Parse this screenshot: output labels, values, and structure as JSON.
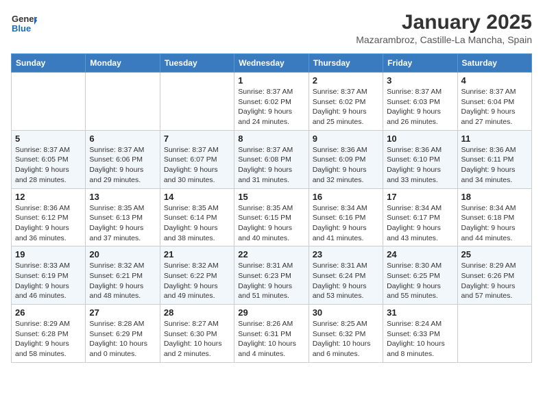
{
  "logo": {
    "line1": "General",
    "line2": "Blue"
  },
  "title": "January 2025",
  "subtitle": "Mazarambroz, Castille-La Mancha, Spain",
  "weekdays": [
    "Sunday",
    "Monday",
    "Tuesday",
    "Wednesday",
    "Thursday",
    "Friday",
    "Saturday"
  ],
  "weeks": [
    [
      {
        "day": "",
        "sunrise": "",
        "sunset": "",
        "daylight": ""
      },
      {
        "day": "",
        "sunrise": "",
        "sunset": "",
        "daylight": ""
      },
      {
        "day": "",
        "sunrise": "",
        "sunset": "",
        "daylight": ""
      },
      {
        "day": "1",
        "sunrise": "Sunrise: 8:37 AM",
        "sunset": "Sunset: 6:02 PM",
        "daylight": "Daylight: 9 hours and 24 minutes."
      },
      {
        "day": "2",
        "sunrise": "Sunrise: 8:37 AM",
        "sunset": "Sunset: 6:02 PM",
        "daylight": "Daylight: 9 hours and 25 minutes."
      },
      {
        "day": "3",
        "sunrise": "Sunrise: 8:37 AM",
        "sunset": "Sunset: 6:03 PM",
        "daylight": "Daylight: 9 hours and 26 minutes."
      },
      {
        "day": "4",
        "sunrise": "Sunrise: 8:37 AM",
        "sunset": "Sunset: 6:04 PM",
        "daylight": "Daylight: 9 hours and 27 minutes."
      }
    ],
    [
      {
        "day": "5",
        "sunrise": "Sunrise: 8:37 AM",
        "sunset": "Sunset: 6:05 PM",
        "daylight": "Daylight: 9 hours and 28 minutes."
      },
      {
        "day": "6",
        "sunrise": "Sunrise: 8:37 AM",
        "sunset": "Sunset: 6:06 PM",
        "daylight": "Daylight: 9 hours and 29 minutes."
      },
      {
        "day": "7",
        "sunrise": "Sunrise: 8:37 AM",
        "sunset": "Sunset: 6:07 PM",
        "daylight": "Daylight: 9 hours and 30 minutes."
      },
      {
        "day": "8",
        "sunrise": "Sunrise: 8:37 AM",
        "sunset": "Sunset: 6:08 PM",
        "daylight": "Daylight: 9 hours and 31 minutes."
      },
      {
        "day": "9",
        "sunrise": "Sunrise: 8:36 AM",
        "sunset": "Sunset: 6:09 PM",
        "daylight": "Daylight: 9 hours and 32 minutes."
      },
      {
        "day": "10",
        "sunrise": "Sunrise: 8:36 AM",
        "sunset": "Sunset: 6:10 PM",
        "daylight": "Daylight: 9 hours and 33 minutes."
      },
      {
        "day": "11",
        "sunrise": "Sunrise: 8:36 AM",
        "sunset": "Sunset: 6:11 PM",
        "daylight": "Daylight: 9 hours and 34 minutes."
      }
    ],
    [
      {
        "day": "12",
        "sunrise": "Sunrise: 8:36 AM",
        "sunset": "Sunset: 6:12 PM",
        "daylight": "Daylight: 9 hours and 36 minutes."
      },
      {
        "day": "13",
        "sunrise": "Sunrise: 8:35 AM",
        "sunset": "Sunset: 6:13 PM",
        "daylight": "Daylight: 9 hours and 37 minutes."
      },
      {
        "day": "14",
        "sunrise": "Sunrise: 8:35 AM",
        "sunset": "Sunset: 6:14 PM",
        "daylight": "Daylight: 9 hours and 38 minutes."
      },
      {
        "day": "15",
        "sunrise": "Sunrise: 8:35 AM",
        "sunset": "Sunset: 6:15 PM",
        "daylight": "Daylight: 9 hours and 40 minutes."
      },
      {
        "day": "16",
        "sunrise": "Sunrise: 8:34 AM",
        "sunset": "Sunset: 6:16 PM",
        "daylight": "Daylight: 9 hours and 41 minutes."
      },
      {
        "day": "17",
        "sunrise": "Sunrise: 8:34 AM",
        "sunset": "Sunset: 6:17 PM",
        "daylight": "Daylight: 9 hours and 43 minutes."
      },
      {
        "day": "18",
        "sunrise": "Sunrise: 8:34 AM",
        "sunset": "Sunset: 6:18 PM",
        "daylight": "Daylight: 9 hours and 44 minutes."
      }
    ],
    [
      {
        "day": "19",
        "sunrise": "Sunrise: 8:33 AM",
        "sunset": "Sunset: 6:19 PM",
        "daylight": "Daylight: 9 hours and 46 minutes."
      },
      {
        "day": "20",
        "sunrise": "Sunrise: 8:32 AM",
        "sunset": "Sunset: 6:21 PM",
        "daylight": "Daylight: 9 hours and 48 minutes."
      },
      {
        "day": "21",
        "sunrise": "Sunrise: 8:32 AM",
        "sunset": "Sunset: 6:22 PM",
        "daylight": "Daylight: 9 hours and 49 minutes."
      },
      {
        "day": "22",
        "sunrise": "Sunrise: 8:31 AM",
        "sunset": "Sunset: 6:23 PM",
        "daylight": "Daylight: 9 hours and 51 minutes."
      },
      {
        "day": "23",
        "sunrise": "Sunrise: 8:31 AM",
        "sunset": "Sunset: 6:24 PM",
        "daylight": "Daylight: 9 hours and 53 minutes."
      },
      {
        "day": "24",
        "sunrise": "Sunrise: 8:30 AM",
        "sunset": "Sunset: 6:25 PM",
        "daylight": "Daylight: 9 hours and 55 minutes."
      },
      {
        "day": "25",
        "sunrise": "Sunrise: 8:29 AM",
        "sunset": "Sunset: 6:26 PM",
        "daylight": "Daylight: 9 hours and 57 minutes."
      }
    ],
    [
      {
        "day": "26",
        "sunrise": "Sunrise: 8:29 AM",
        "sunset": "Sunset: 6:28 PM",
        "daylight": "Daylight: 9 hours and 58 minutes."
      },
      {
        "day": "27",
        "sunrise": "Sunrise: 8:28 AM",
        "sunset": "Sunset: 6:29 PM",
        "daylight": "Daylight: 10 hours and 0 minutes."
      },
      {
        "day": "28",
        "sunrise": "Sunrise: 8:27 AM",
        "sunset": "Sunset: 6:30 PM",
        "daylight": "Daylight: 10 hours and 2 minutes."
      },
      {
        "day": "29",
        "sunrise": "Sunrise: 8:26 AM",
        "sunset": "Sunset: 6:31 PM",
        "daylight": "Daylight: 10 hours and 4 minutes."
      },
      {
        "day": "30",
        "sunrise": "Sunrise: 8:25 AM",
        "sunset": "Sunset: 6:32 PM",
        "daylight": "Daylight: 10 hours and 6 minutes."
      },
      {
        "day": "31",
        "sunrise": "Sunrise: 8:24 AM",
        "sunset": "Sunset: 6:33 PM",
        "daylight": "Daylight: 10 hours and 8 minutes."
      },
      {
        "day": "",
        "sunrise": "",
        "sunset": "",
        "daylight": ""
      }
    ]
  ]
}
